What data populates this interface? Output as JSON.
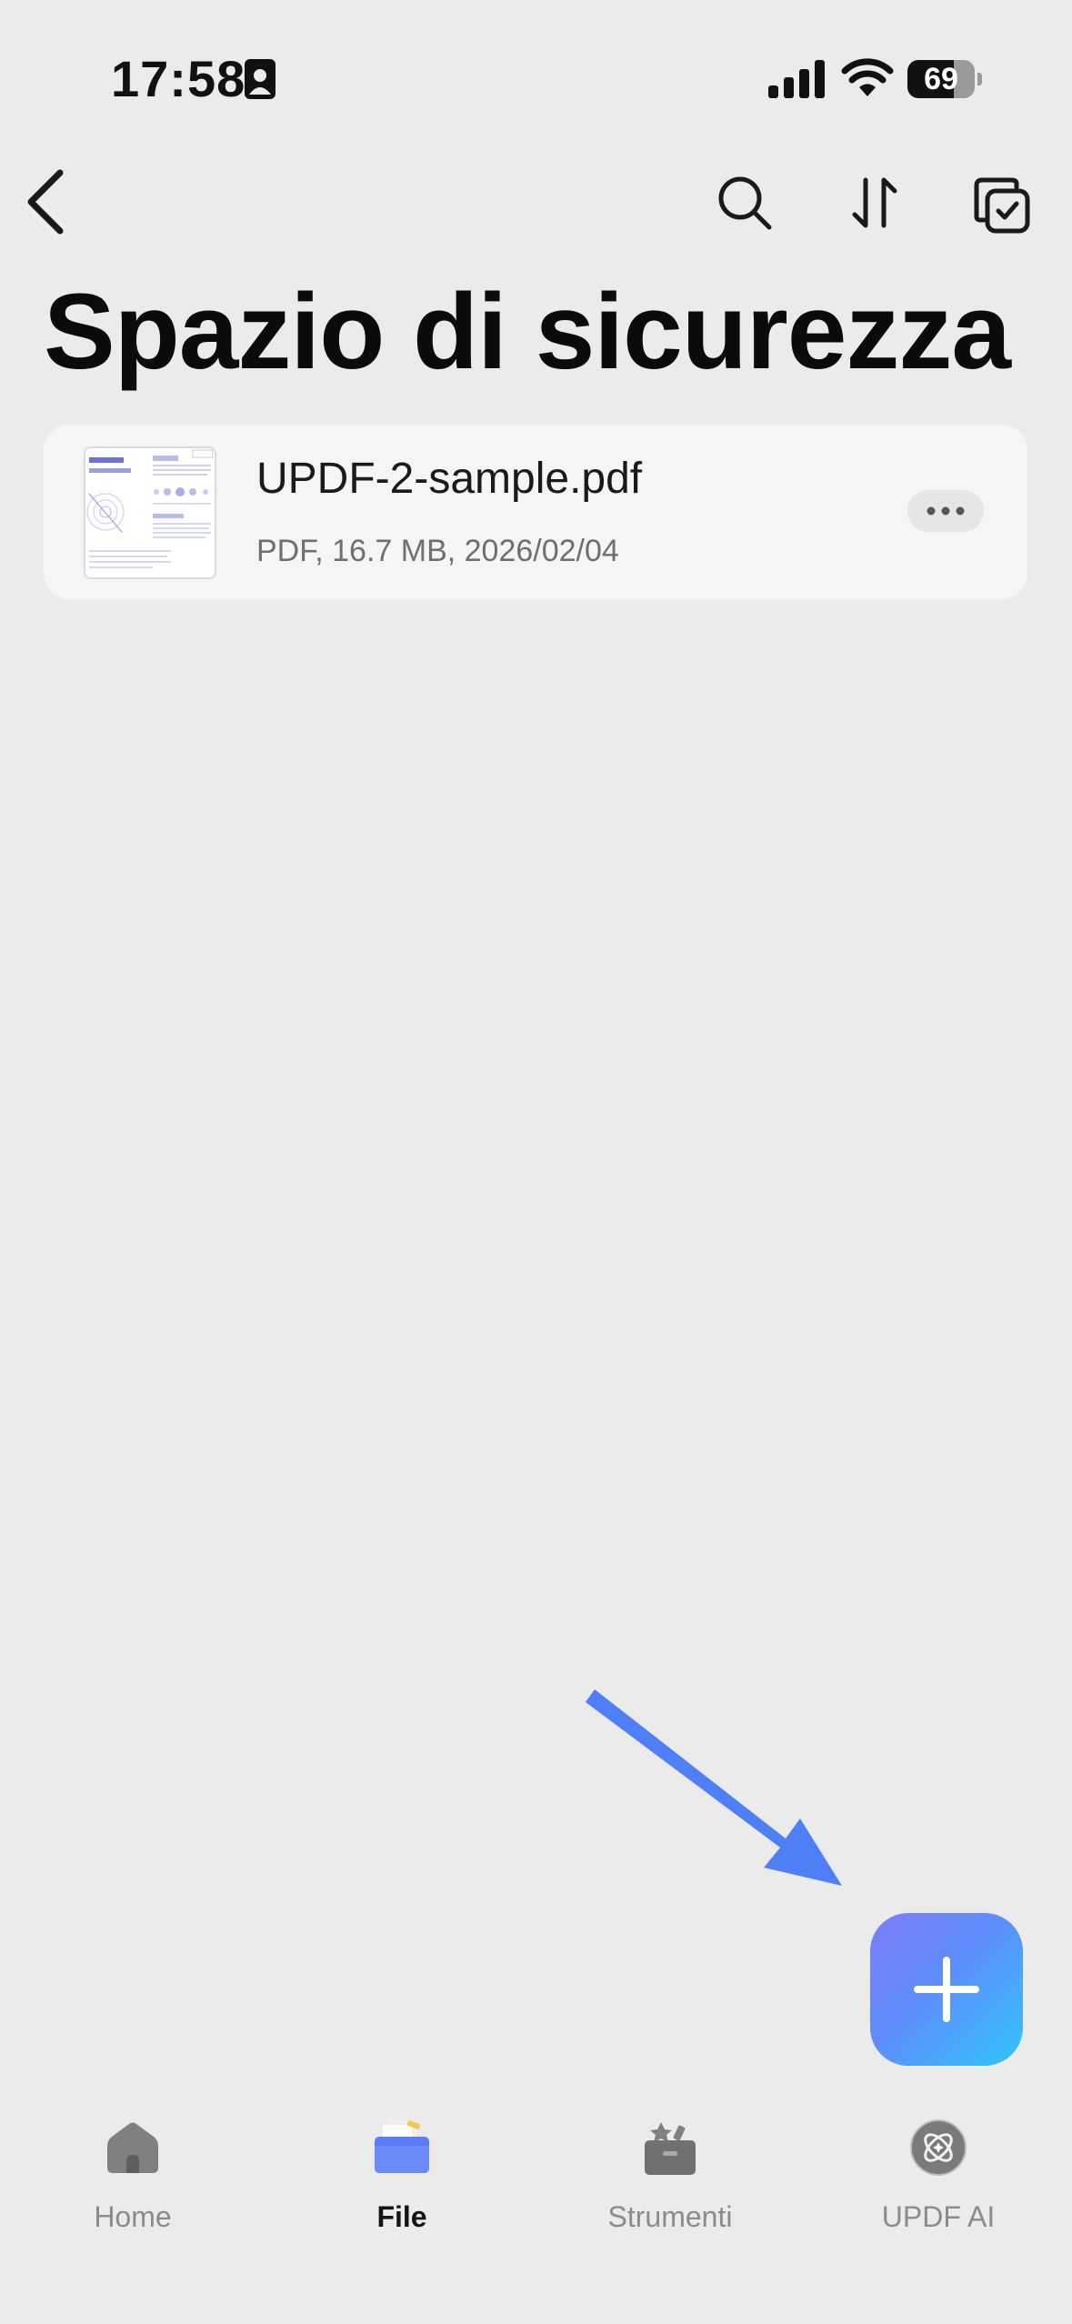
{
  "status_bar": {
    "time": "17:58",
    "battery": "69",
    "battery_level": 0.69
  },
  "nav": {
    "icons": [
      "chevron-left-icon",
      "search-icon",
      "sort-icon",
      "select-icon"
    ]
  },
  "page": {
    "title": "Spazio di sicurezza"
  },
  "files": [
    {
      "name": "UPDF-2-sample.pdf",
      "meta": "PDF, 16.7 MB, 2026/02/04"
    }
  ],
  "fab": {
    "icon": "plus-icon"
  },
  "tabs": [
    {
      "label": "Home",
      "icon": "home-icon",
      "active": false
    },
    {
      "label": "File",
      "icon": "folder-icon",
      "active": true
    },
    {
      "label": "Strumenti",
      "icon": "toolbox-icon",
      "active": false
    },
    {
      "label": "UPDF AI",
      "icon": "ai-icon",
      "active": false
    }
  ],
  "colors": {
    "accent": "#5d8dfa",
    "fab_start": "#7e7cf7",
    "fab_end": "#2fc6fb",
    "arrow": "#4f7ff7",
    "background": "#ebebeb"
  }
}
